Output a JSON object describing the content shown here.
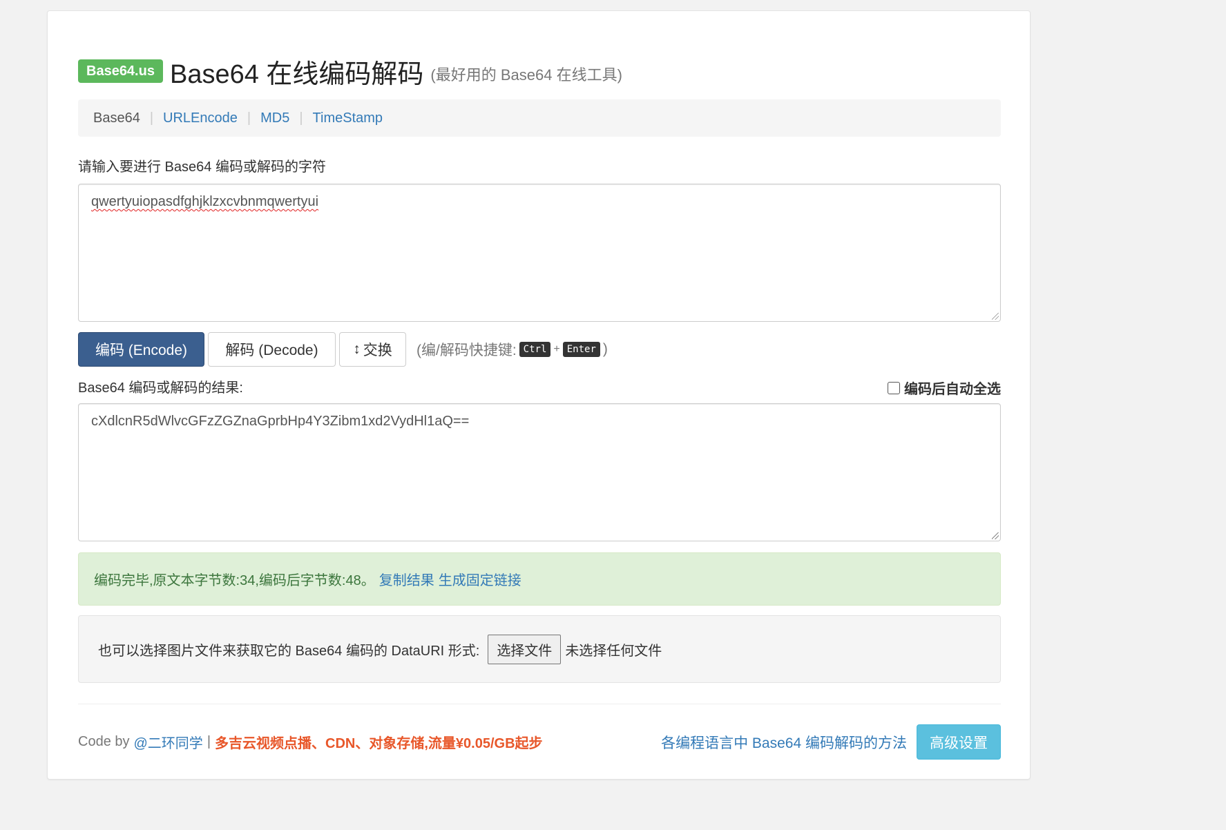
{
  "header": {
    "badge": "Base64.us",
    "title": "Base64 在线编码解码",
    "subtitle": "(最好用的 Base64 在线工具)"
  },
  "nav": {
    "items": [
      {
        "label": "Base64",
        "active": true
      },
      {
        "label": "URLEncode"
      },
      {
        "label": "MD5"
      },
      {
        "label": "TimeStamp"
      }
    ],
    "separator": "|"
  },
  "input": {
    "label": "请输入要进行 Base64 编码或解码的字符",
    "value": "qwertyuiopasdfghjklzxcvbnmqwertyui"
  },
  "buttons": {
    "encode": "编码 (Encode)",
    "decode": "解码 (Decode)",
    "swap_icon": "↕",
    "swap": "交换"
  },
  "shortcut": {
    "prefix": "(编/解码快捷键:",
    "key1": "Ctrl",
    "plus": "+",
    "key2": "Enter",
    "suffix": ")"
  },
  "output": {
    "label": "Base64 编码或解码的结果:",
    "value": "cXdlcnR5dWlvcGFzZGZnaGprbHp4Y3Zibm1xd2VydHl1aQ==",
    "auto_select_label": "编码后自动全选"
  },
  "alert": {
    "message": "编码完毕,原文本字节数:34,编码后字节数:48。",
    "copy_link": "复制结果",
    "permalink": "生成固定链接"
  },
  "file": {
    "label": "也可以选择图片文件来获取它的 Base64 编码的 DataURI 形式:",
    "button": "选择文件",
    "status": "未选择任何文件"
  },
  "footer": {
    "code_by": "Code by",
    "author": "@二环同学",
    "sep": "|",
    "promo": "多吉云视频点播、CDN、对象存储,流量¥0.05/GB起步",
    "methods_link": "各编程语言中 Base64 编码解码的方法",
    "advanced_button": "高级设置"
  },
  "colors": {
    "badge": "#5cb85c",
    "primary": "#3b5f8f",
    "link": "#337ab7",
    "promo": "#e8572a",
    "info": "#5bc0de",
    "alert_bg": "#dff0d8"
  }
}
